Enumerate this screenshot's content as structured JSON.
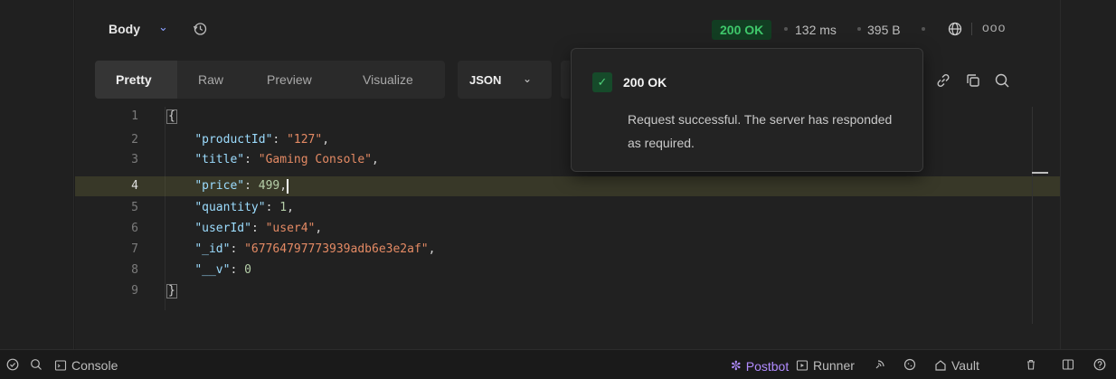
{
  "response": {
    "body_label": "Body",
    "status": "200 OK",
    "time": "132 ms",
    "size": "395 B",
    "more": "ooo"
  },
  "view_tabs": [
    "Pretty",
    "Raw",
    "Preview",
    "Visualize"
  ],
  "format": {
    "selected": "JSON"
  },
  "tooltip": {
    "title": "200 OK",
    "description": "Request successful. The server has responded as required."
  },
  "editor": {
    "lines": [
      {
        "n": "1"
      },
      {
        "n": "2",
        "key": "\"productId\"",
        "val": "\"127\"",
        "type": "str",
        "trail": ","
      },
      {
        "n": "3",
        "key": "\"title\"",
        "val": "\"Gaming Console\"",
        "type": "str",
        "trail": ","
      },
      {
        "n": "4",
        "key": "\"price\"",
        "val": "499",
        "type": "num",
        "trail": ","
      },
      {
        "n": "5",
        "key": "\"quantity\"",
        "val": "1",
        "type": "num",
        "trail": ","
      },
      {
        "n": "6",
        "key": "\"userId\"",
        "val": "\"user4\"",
        "type": "str",
        "trail": ","
      },
      {
        "n": "7",
        "key": "\"_id\"",
        "val": "\"67764797773939adb6e3e2af\"",
        "type": "str",
        "trail": ","
      },
      {
        "n": "8",
        "key": "\"__v\"",
        "val": "0",
        "type": "num",
        "trail": ""
      },
      {
        "n": "9"
      }
    ],
    "open_brace": "{",
    "close_brace": "}"
  },
  "statusbar": {
    "console": "Console",
    "postbot": "Postbot",
    "runner": "Runner",
    "vault": "Vault"
  },
  "colors": {
    "status_ok": "#3fc86b",
    "postbot": "#b18cff"
  }
}
